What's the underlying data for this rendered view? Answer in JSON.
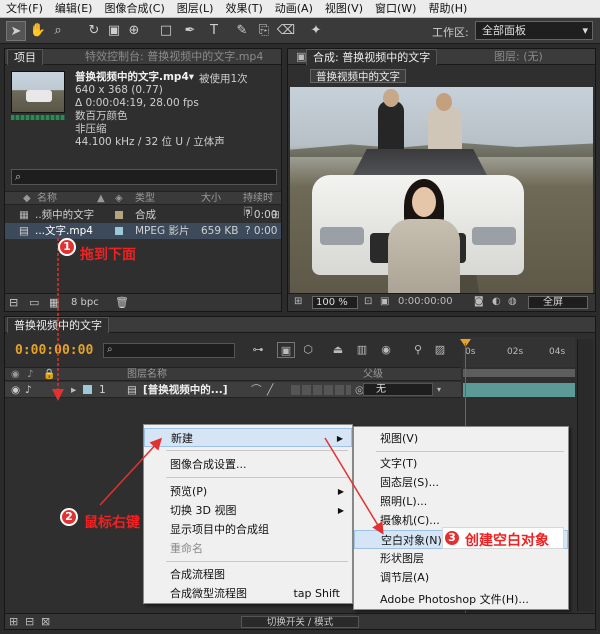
{
  "menubar": [
    "文件(F)",
    "编辑(E)",
    "图像合成(C)",
    "图层(L)",
    "效果(T)",
    "动画(A)",
    "视图(V)",
    "窗口(W)",
    "帮助(H)"
  ],
  "toolbar": {
    "workspace_label": "工作区:",
    "workspace_value": "全部面板"
  },
  "project_panel": {
    "tab_project": "项目",
    "tab_effects": "特效控制台: 普换视频中的文字.mp4",
    "file_name": "普换视频中的文字.mp4▾",
    "used_count": "被使用1次",
    "resolution": "640 x 368 (0.77)",
    "duration": "Δ 0:00:04:19, 28.00 fps",
    "color_depth": "数百万颜色",
    "compression": "非压缩",
    "audio": "44.100 kHz / 32 位 U / 立体声",
    "columns": {
      "name": "名称",
      "type": "类型",
      "size": "大小",
      "duration": "持续时间"
    },
    "rows": [
      {
        "name": "..频中的文字",
        "type": "合成",
        "size": "",
        "duration": "? 0:00",
        "swatch": "#b4a582"
      },
      {
        "name": "...文字.mp4",
        "type": "MPEG 影片",
        "size": "659 KB",
        "duration": "? 0:00",
        "swatch": "#9cc9d6"
      }
    ],
    "bpc": "8 bpc"
  },
  "comp_panel": {
    "tab_comp": "合成: 普换视频中的文字",
    "tab_layer": "图层: (无)",
    "name_tab": "普换视频中的文字",
    "zoom": "100 %",
    "resolution": "全屏"
  },
  "timeline": {
    "tab": "普换视频中的文字",
    "timecode": "0:00:00:00",
    "ruler_ticks": [
      "0s",
      "02s",
      "04s"
    ],
    "columns": {
      "source_name": "图层名称",
      "parent": "父级"
    },
    "layer": {
      "index": "1",
      "name": "[普换视频中的...]",
      "parent": "无"
    },
    "footer_toggle": "切换开关 / 模式"
  },
  "context_menu": {
    "items": [
      "新建",
      "图像合成设置...",
      "预览(P)",
      "切换 3D 视图",
      "显示项目中的合成组",
      "重命名",
      "合成流程图",
      "合成微型流程图"
    ],
    "shortcut": "tap Shift"
  },
  "submenu": {
    "items": [
      "视图(V)",
      "文字(T)",
      "固态层(S)...",
      "照明(L)...",
      "摄像机(C)...",
      "空白对象(N)",
      "形状图层",
      "调节层(A)",
      "Adobe Photoshop 文件(H)..."
    ]
  },
  "annotations": {
    "step1": "拖到下面",
    "step2": "鼠标右键",
    "step3": "创建空白对象",
    "n1": "1",
    "n2": "2",
    "n3": "3"
  }
}
